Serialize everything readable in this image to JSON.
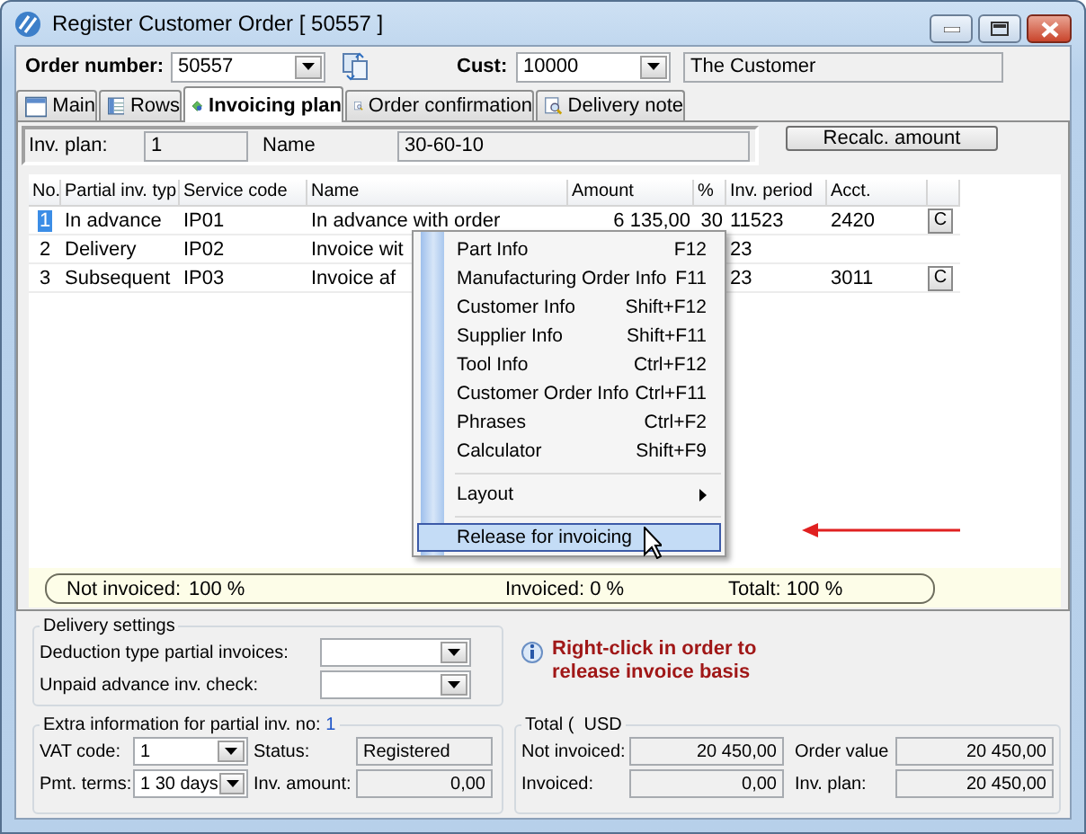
{
  "window": {
    "title": "Register Customer Order [ 50557 ]"
  },
  "header": {
    "order_number_label": "Order number:",
    "order_number": "50557",
    "cust_label": "Cust:",
    "cust": "10000",
    "customer_name": "The Customer"
  },
  "tabs": [
    {
      "label": "Main",
      "selected": false
    },
    {
      "label": "Rows",
      "selected": false
    },
    {
      "label": "Invoicing plan",
      "selected": true
    },
    {
      "label": "Order confirmation",
      "selected": false
    },
    {
      "label": "Delivery note",
      "selected": false
    }
  ],
  "plan": {
    "inv_plan_label": "Inv. plan:",
    "inv_plan": "1",
    "name_label": "Name",
    "name": "30-60-10",
    "recalc_button": "Recalc. amount"
  },
  "grid": {
    "columns": [
      "No.",
      "Partial inv. typ",
      "Service code",
      "Name",
      "Amount",
      "%",
      "Inv. period",
      "Acct."
    ],
    "rows": [
      {
        "no": "1",
        "type": "In advance",
        "service_code": "IP01",
        "name": "In advance with order",
        "amount": "6 135,00",
        "percent": "30",
        "inv_period": "11523",
        "acct": "2420",
        "button": "C",
        "selected": true
      },
      {
        "no": "2",
        "type": "Delivery",
        "service_code": "IP02",
        "name": "Invoice wit",
        "inv_period": "23",
        "selected": false
      },
      {
        "no": "3",
        "type": "Subsequent",
        "service_code": "IP03",
        "name": "Invoice af",
        "inv_period": "23",
        "acct": "3011",
        "button": "C",
        "selected": false
      }
    ]
  },
  "context_menu": {
    "items": [
      {
        "kind": "item",
        "label": "Part Info",
        "shortcut": "F12",
        "selected": false
      },
      {
        "kind": "item",
        "label": "Manufacturing Order Info",
        "shortcut": "F11",
        "selected": false
      },
      {
        "kind": "item",
        "label": "Customer Info",
        "shortcut": "Shift+F12",
        "selected": false
      },
      {
        "kind": "item",
        "label": "Supplier Info",
        "shortcut": "Shift+F11",
        "selected": false
      },
      {
        "kind": "item",
        "label": "Tool Info",
        "shortcut": "Ctrl+F12",
        "selected": false
      },
      {
        "kind": "item",
        "label": "Customer Order Info",
        "shortcut": "Ctrl+F11",
        "selected": false
      },
      {
        "kind": "item",
        "label": "Phrases",
        "shortcut": "Ctrl+F2",
        "selected": false
      },
      {
        "kind": "item",
        "label": "Calculator",
        "shortcut": "Shift+F9",
        "selected": false
      },
      {
        "kind": "separator"
      },
      {
        "kind": "submenu",
        "label": "Layout",
        "selected": false
      },
      {
        "kind": "separator"
      },
      {
        "kind": "item",
        "label": "Release for invoicing",
        "selected": true
      }
    ]
  },
  "summary": {
    "not_invoiced_label": "Not invoiced:",
    "not_invoiced": "100 %",
    "invoiced": "Invoiced: 0 %",
    "total": "Totalt: 100 %"
  },
  "delivery_settings": {
    "title": "Delivery settings",
    "fields": [
      {
        "label": "Deduction type partial invoices:"
      },
      {
        "label": "Unpaid advance inv. check:"
      }
    ]
  },
  "hint": "Right-click in order to release invoice basis",
  "extra": {
    "title": "Extra information for partial inv. no:",
    "number": "1",
    "vat_label": "VAT code:",
    "vat": "1",
    "status_label": "Status:",
    "status": "Registered",
    "pmt_label": "Pmt. terms:",
    "pmt": "1  30 days",
    "inv_amount_label": "Inv. amount:",
    "inv_amount": "0,00"
  },
  "total": {
    "title": "Total (  USD",
    "not_invoiced_label": "Not invoiced:",
    "not_invoiced": "20 450,00",
    "order_value_label": "Order value",
    "order_value": "20 450,00",
    "invoiced_label": "Invoiced:",
    "invoiced": "0,00",
    "inv_plan_label": "Inv. plan:",
    "inv_plan": "20 450,00"
  }
}
